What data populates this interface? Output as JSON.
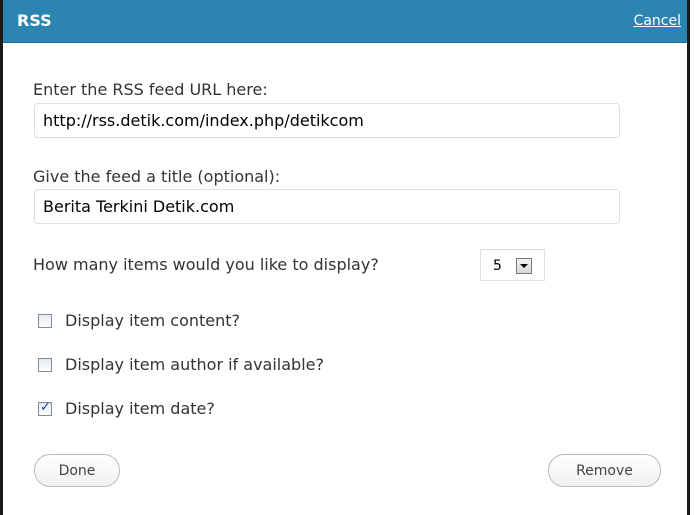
{
  "header": {
    "title": "RSS",
    "cancel_label": "Cancel"
  },
  "form": {
    "url_label": "Enter the RSS feed URL here:",
    "url_value": "http://rss.detik.com/index.php/detikcom",
    "title_label": "Give the feed a title (optional):",
    "title_value": "Berita Terkini Detik.com",
    "items_label": "How many items would you like to display?",
    "items_selected": "5",
    "options": [
      {
        "label": "Display item content?",
        "checked": false
      },
      {
        "label": "Display item author if available?",
        "checked": false
      },
      {
        "label": "Display item date?",
        "checked": true
      }
    ]
  },
  "actions": {
    "done_label": "Done",
    "remove_label": "Remove"
  },
  "colors": {
    "header_bg": "#2c84b0",
    "header_text": "#ffffff"
  }
}
